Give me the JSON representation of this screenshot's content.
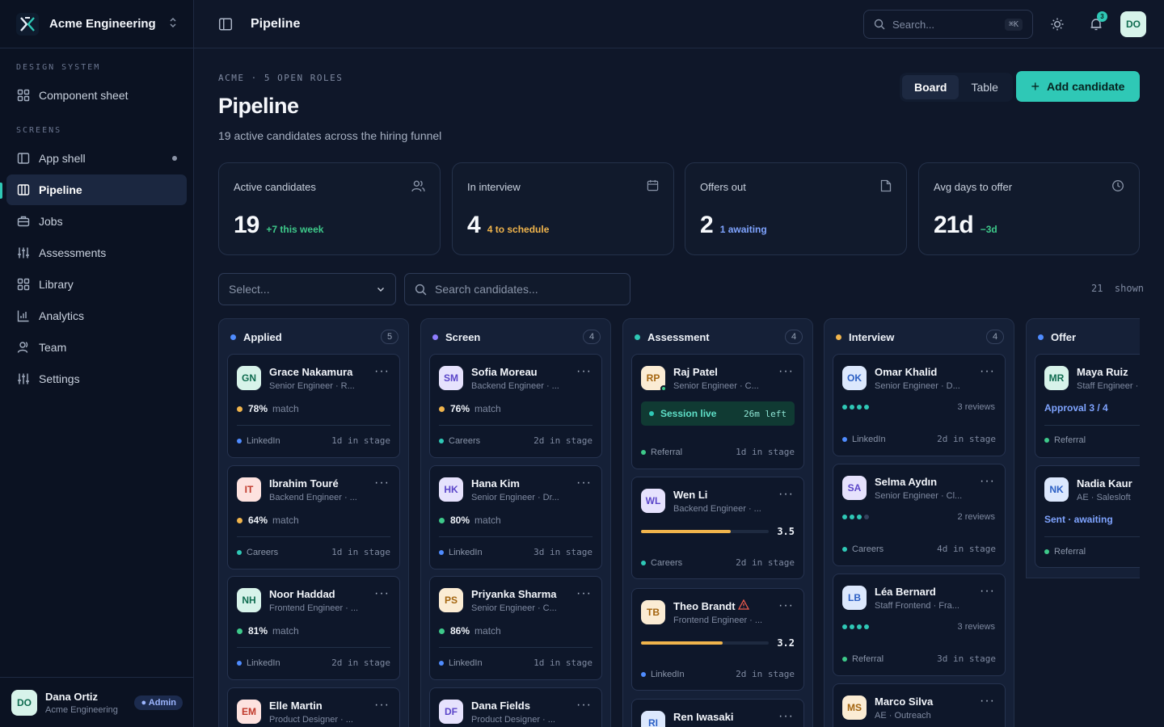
{
  "workspace": {
    "name": "Acme Engineering"
  },
  "sidebar": {
    "sections": [
      {
        "label": "DESIGN SYSTEM"
      },
      {
        "label": "SCREENS"
      }
    ],
    "items": [
      {
        "label": "Component sheet"
      },
      {
        "label": "App shell"
      },
      {
        "label": "Pipeline"
      },
      {
        "label": "Jobs"
      },
      {
        "label": "Assessments"
      },
      {
        "label": "Library"
      },
      {
        "label": "Analytics"
      },
      {
        "label": "Team"
      },
      {
        "label": "Settings"
      }
    ],
    "user": {
      "initials": "DO",
      "name": "Dana Ortiz",
      "org": "Acme Engineering",
      "role": "● Admin"
    }
  },
  "topbar": {
    "title": "Pipeline",
    "search_placeholder": "Search...",
    "shortcut": "⌘K",
    "notifications": "3",
    "avatar": "DO"
  },
  "header": {
    "eyebrow": "ACME · 5 OPEN ROLES",
    "title": "Pipeline",
    "subtitle": "19 active candidates across the hiring funnel",
    "views": [
      "Board",
      "Table"
    ],
    "add_label": "Add candidate"
  },
  "stats": [
    {
      "label": "Active candidates",
      "value": "19",
      "delta": "+7 this week",
      "color": "#3ec98a"
    },
    {
      "label": "In interview",
      "value": "4",
      "delta": "4 to schedule",
      "color": "#f0b44c"
    },
    {
      "label": "Offers out",
      "value": "2",
      "delta": "1 awaiting",
      "color": "#7fa4ff"
    },
    {
      "label": "Avg days to offer",
      "value": "21d",
      "delta": "−3d",
      "color": "#3ec98a"
    }
  ],
  "filters": {
    "select_placeholder": "Select...",
    "search_placeholder": "Search candidates...",
    "shown": "21  shown"
  },
  "columns": [
    {
      "name": "Applied",
      "count": "5",
      "color": "#4f8cff"
    },
    {
      "name": "Screen",
      "count": "4",
      "color": "#8f7dff"
    },
    {
      "name": "Assessment",
      "count": "4",
      "color": "#2fc8b6"
    },
    {
      "name": "Interview",
      "count": "4",
      "color": "#f0b44c"
    },
    {
      "name": "Offer",
      "count": "",
      "color": "#4f8cff"
    }
  ],
  "cards": {
    "applied": [
      {
        "initials": "GN",
        "name": "Grace Nakamura",
        "role": "Senior Engineer · R...",
        "match": "78%",
        "match_label": "match",
        "source": "LinkedIn",
        "days": "1d in stage"
      },
      {
        "initials": "IT",
        "name": "Ibrahim Touré",
        "role": "Backend Engineer · ...",
        "match": "64%",
        "match_label": "match",
        "source": "Careers",
        "days": "1d in stage"
      },
      {
        "initials": "NH",
        "name": "Noor Haddad",
        "role": "Frontend Engineer · ...",
        "match": "81%",
        "match_label": "match",
        "source": "LinkedIn",
        "days": "2d in stage"
      },
      {
        "initials": "EM",
        "name": "Elle Martin",
        "role": "Product Designer · ..."
      }
    ],
    "screen": [
      {
        "initials": "SM",
        "name": "Sofia Moreau",
        "role": "Backend Engineer · ...",
        "match": "76%",
        "match_label": "match",
        "source": "Careers",
        "days": "2d in stage"
      },
      {
        "initials": "HK",
        "name": "Hana Kim",
        "role": "Senior Engineer · Dr...",
        "match": "80%",
        "match_label": "match",
        "source": "LinkedIn",
        "days": "3d in stage"
      },
      {
        "initials": "PS",
        "name": "Priyanka Sharma",
        "role": "Senior Engineer · C...",
        "match": "86%",
        "match_label": "match",
        "source": "LinkedIn",
        "days": "1d in stage"
      },
      {
        "initials": "DF",
        "name": "Dana Fields",
        "role": "Product Designer · ..."
      }
    ],
    "assessment": [
      {
        "initials": "RP",
        "name": "Raj Patel",
        "role": "Senior Engineer · C...",
        "session": "Session live",
        "time_left": "26m left",
        "source": "Referral",
        "days": "1d in stage"
      },
      {
        "initials": "WL",
        "name": "Wen Li",
        "role": "Backend Engineer · ...",
        "score": "3.5",
        "score_frac": 0.7,
        "source": "Careers",
        "days": "2d in stage"
      },
      {
        "initials": "TB",
        "name": "Theo Brandt",
        "role": "Frontend Engineer · ...",
        "score": "3.2",
        "score_frac": 0.64,
        "source": "LinkedIn",
        "days": "2d in stage"
      },
      {
        "initials": "RI",
        "name": "Ren Iwasaki"
      }
    ],
    "interview": [
      {
        "initials": "OK",
        "name": "Omar Khalid",
        "role": "Senior Engineer · D...",
        "reviews": "3 reviews",
        "source": "LinkedIn",
        "days": "2d in stage"
      },
      {
        "initials": "SA",
        "name": "Selma Aydın",
        "role": "Senior Engineer · Cl...",
        "reviews": "2 reviews",
        "source": "Careers",
        "days": "4d in stage"
      },
      {
        "initials": "LB",
        "name": "Léa Bernard",
        "role": "Staff Frontend · Fra...",
        "reviews": "3 reviews",
        "source": "Referral",
        "days": "3d in stage"
      },
      {
        "initials": "MS",
        "name": "Marco Silva",
        "role": "AE · Outreach"
      }
    ],
    "offer": [
      {
        "initials": "MR",
        "name": "Maya Ruiz",
        "role": "Staff Engineer ·",
        "status": "Approval 3 / 4",
        "source": "Referral"
      },
      {
        "initials": "NK",
        "name": "Nadia Kaur",
        "role": "AE · Salesloft",
        "status": "Sent · awaiting",
        "source": "Referral"
      }
    ]
  }
}
